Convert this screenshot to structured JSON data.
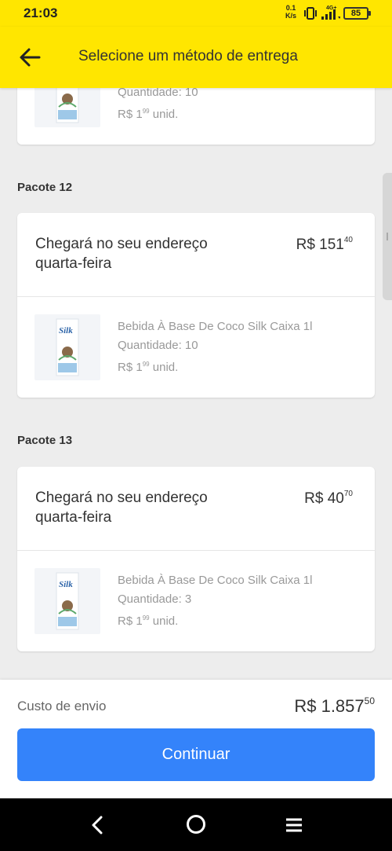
{
  "status_bar": {
    "time": "21:03",
    "speed_value": "0.1",
    "speed_unit": "K/s",
    "network": "4G+",
    "battery": "85"
  },
  "header": {
    "title": "Selecione um método de entrega",
    "back_icon": "arrow-left-icon"
  },
  "previous_card": {
    "quantity": "Quantidade: 10",
    "unit_price": {
      "main": "R$ 1",
      "cents": "99",
      "suffix": " unid."
    }
  },
  "packages": [
    {
      "title": "Pacote 12",
      "delivery": "Chegará no seu endereço quarta-feira",
      "price": {
        "main": "R$ 151",
        "cents": "40"
      },
      "item": {
        "name": "Bebida À Base De Coco Silk Caixa 1l",
        "quantity": "Quantidade: 10",
        "unit_price": {
          "main": "R$ 1",
          "cents": "99",
          "suffix": " unid."
        }
      }
    },
    {
      "title": "Pacote 13",
      "delivery": "Chegará no seu endereço quarta-feira",
      "price": {
        "main": "R$ 40",
        "cents": "70"
      },
      "item": {
        "name": "Bebida À Base De Coco Silk Caixa 1l",
        "quantity": "Quantidade: 3",
        "unit_price": {
          "main": "R$ 1",
          "cents": "99",
          "suffix": " unid."
        }
      }
    }
  ],
  "product_brand": "Silk",
  "footer": {
    "shipping_label": "Custo de envio",
    "shipping_price": {
      "main": "R$ 1.857",
      "cents": "50"
    },
    "continue_label": "Continuar"
  },
  "colors": {
    "header": "#ffe600",
    "primary_button": "#3483fa",
    "background": "#ededed"
  },
  "nav_bar": {
    "icons": [
      "back-icon",
      "home-icon",
      "menu-icon"
    ]
  }
}
